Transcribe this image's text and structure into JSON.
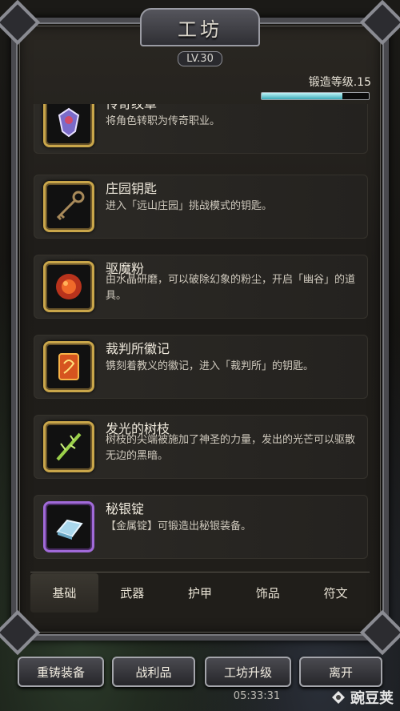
{
  "window": {
    "title": "工坊",
    "level": "LV.30"
  },
  "forge": {
    "label": "锻造等级.15",
    "progress": 0.75
  },
  "items": [
    {
      "name": "传奇纹章",
      "desc": "将角色转职为传奇职业。",
      "icon": "crest-icon"
    },
    {
      "name": "庄园钥匙",
      "desc": "进入「远山庄园」挑战模式的钥匙。",
      "icon": "key-icon"
    },
    {
      "name": "驱魔粉",
      "desc": "由水晶研磨，可以破除幻象的粉尘，开启「幽谷」的道具。",
      "icon": "powder-icon"
    },
    {
      "name": "裁判所徽记",
      "desc": "镌刻着教义的徽记，进入「裁判所」的钥匙。",
      "icon": "emblem-icon"
    },
    {
      "name": "发光的树枝",
      "desc": "树枝的尖端被施加了神圣的力量，发出的光芒可以驱散无边的黑暗。",
      "icon": "branch-icon"
    },
    {
      "name": "秘银锭",
      "desc": "【金属锭】可锻造出秘银装备。",
      "icon": "ingot-icon"
    }
  ],
  "tabs": [
    "基础",
    "武器",
    "护甲",
    "饰品",
    "符文"
  ],
  "buttons": {
    "recast": "重铸装备",
    "loot": "战利品",
    "upgrade": "工坊升级",
    "leave": "离开"
  },
  "time": "05:33:31",
  "watermark": "豌豆荚"
}
